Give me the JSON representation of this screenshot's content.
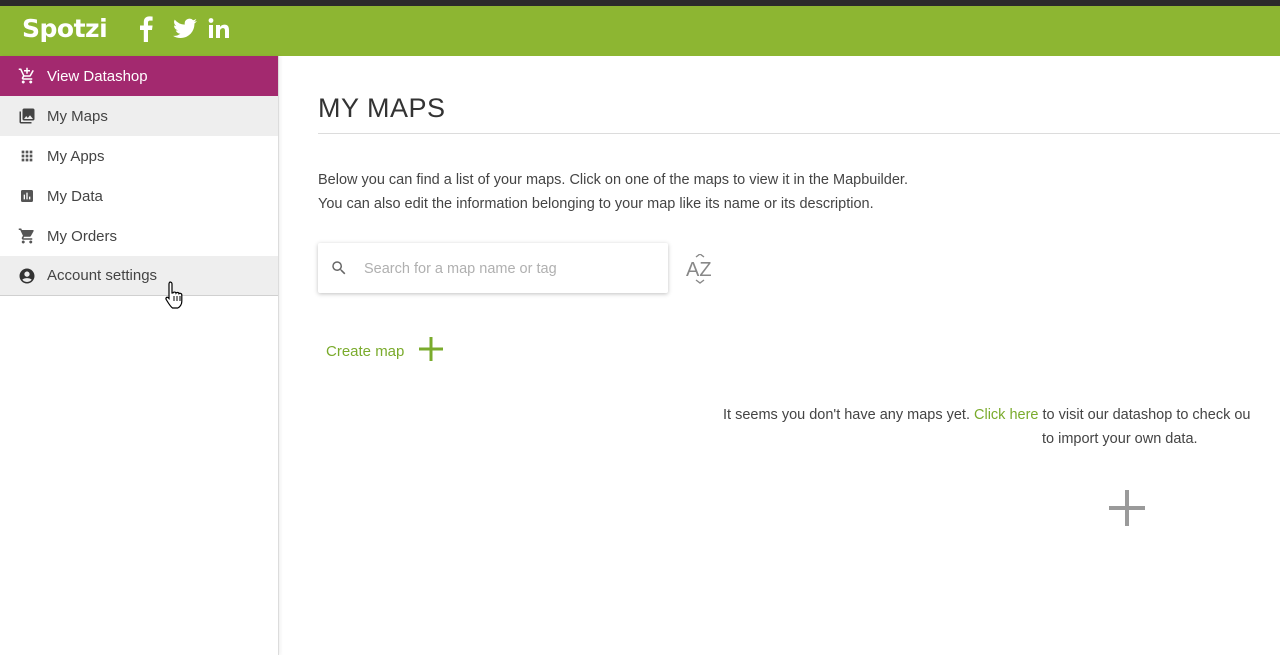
{
  "brand": {
    "logo": "Spotzi"
  },
  "social": [
    "facebook-icon",
    "twitter-icon",
    "linkedin-icon"
  ],
  "colors": {
    "topbar": "#8db632",
    "datashop": "#a3296f",
    "link": "#7aab2c"
  },
  "sidebar": {
    "items": [
      {
        "label": "View Datashop",
        "icon": "cart-add-icon"
      },
      {
        "label": "My Maps",
        "icon": "image-icon"
      },
      {
        "label": "My Apps",
        "icon": "grid-icon"
      },
      {
        "label": "My Data",
        "icon": "bar-chart-icon"
      },
      {
        "label": "My Orders",
        "icon": "cart-icon"
      },
      {
        "label": "Account settings",
        "icon": "account-circle-icon"
      }
    ]
  },
  "main": {
    "title": "MY MAPS",
    "desc_line1": "Below you can find a list of your maps. Click on one of the maps to view it in the Mapbuilder.",
    "desc_line2": "You can also edit the information belonging to your map like its name or its description.",
    "search_placeholder": "Search for a map name or tag",
    "sort_label": "AZ",
    "create_label": "Create map",
    "empty_text_before": "It seems you don't have any maps yet.",
    "empty_link": "Click here",
    "empty_text_after": "to visit our datashop to check ou",
    "empty_line2": "to import your own data."
  }
}
